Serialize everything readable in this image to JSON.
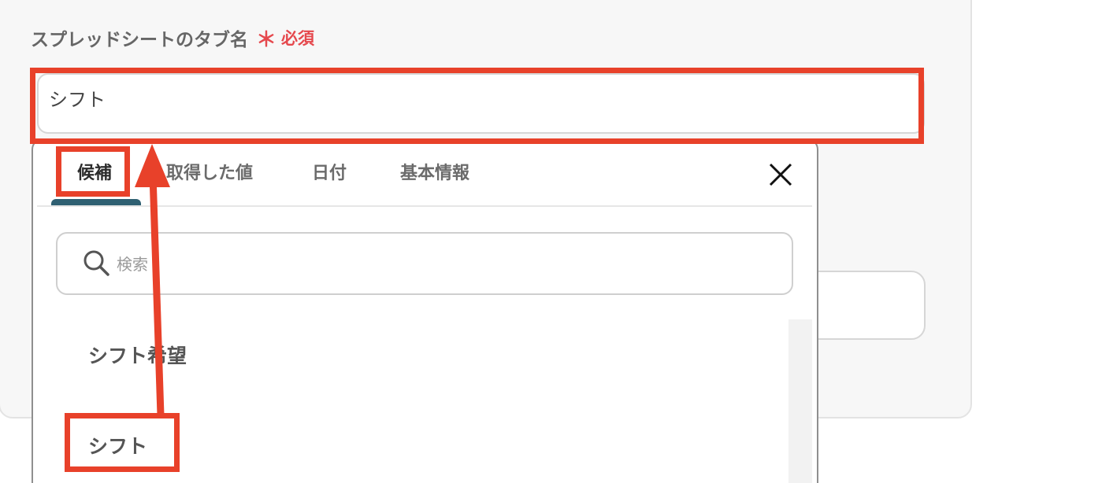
{
  "field": {
    "label": "スプレッドシートのタブ名",
    "required_star": "＊",
    "required_text": "必須",
    "value": "シフト"
  },
  "dropdown": {
    "tabs": [
      {
        "label": "候補",
        "active": true
      },
      {
        "label": "取得した値",
        "active": false
      },
      {
        "label": "日付",
        "active": false
      },
      {
        "label": "基本情報",
        "active": false
      }
    ],
    "close_icon": "close-icon",
    "search": {
      "placeholder": "検索",
      "icon": "search-icon"
    },
    "options": [
      {
        "label": "シフト希望"
      },
      {
        "label": "シフト"
      }
    ]
  },
  "annotation": {
    "highlight_color": "#e8412a",
    "active_tab_color": "#2f6072",
    "required_color": "#e5484d"
  }
}
